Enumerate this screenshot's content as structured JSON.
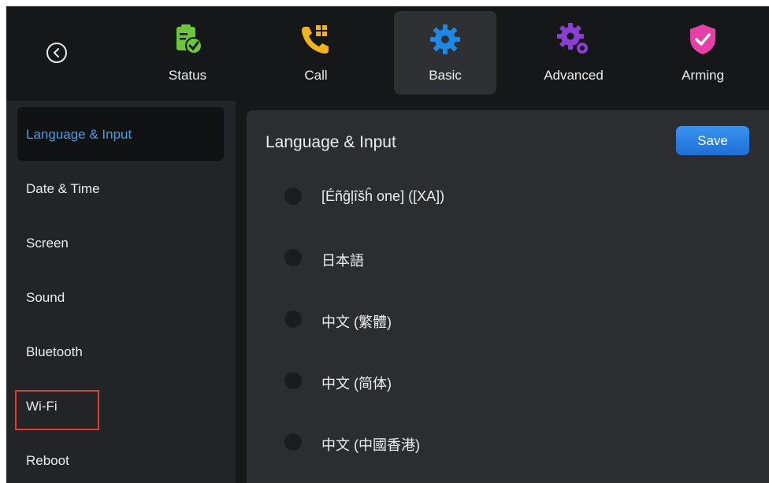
{
  "topbar": {
    "tabs": [
      {
        "label": "Status",
        "icon": "clipboard-check-icon"
      },
      {
        "label": "Call",
        "icon": "phone-keypad-icon"
      },
      {
        "label": "Basic",
        "icon": "gear-icon"
      },
      {
        "label": "Advanced",
        "icon": "gears-icon"
      },
      {
        "label": "Arming",
        "icon": "shield-check-icon"
      }
    ],
    "active_tab": "Basic"
  },
  "sidebar": {
    "items": [
      {
        "label": "Language & Input"
      },
      {
        "label": "Date & Time"
      },
      {
        "label": "Screen"
      },
      {
        "label": "Sound"
      },
      {
        "label": "Bluetooth"
      },
      {
        "label": "Wi-Fi"
      },
      {
        "label": "Reboot"
      }
    ],
    "active_item": "Language & Input",
    "highlighted_item": "Wi-Fi"
  },
  "panel": {
    "title": "Language & Input",
    "save_label": "Save",
    "languages": [
      {
        "label": "[Éñĝļîšĥ one] ([XA])"
      },
      {
        "label": "日本語"
      },
      {
        "label": "中文 (繁體)"
      },
      {
        "label": "中文 (简体)"
      },
      {
        "label": "中文 (中國香港)"
      }
    ]
  },
  "colors": {
    "accent_blue": "#3f9fe6",
    "status_green": "#6cc63a",
    "call_yellow": "#f3b11a",
    "basic_blue": "#1e88e5",
    "advanced_purple": "#8a3fd1",
    "arming_pink": "#e53fa8",
    "highlight_red": "#e23b2f"
  }
}
